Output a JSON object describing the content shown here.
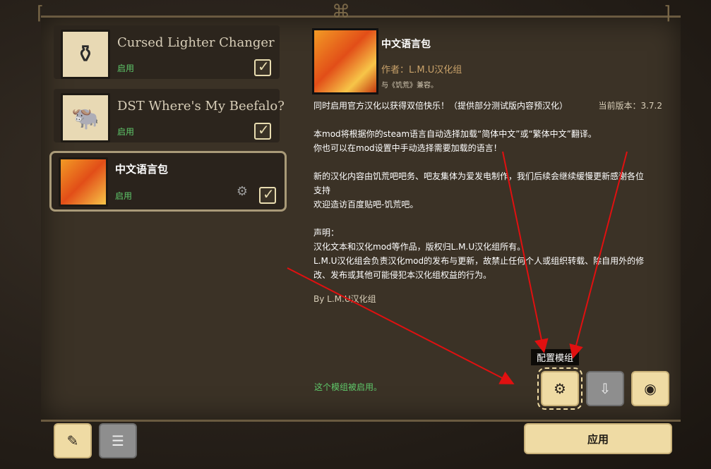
{
  "mods": [
    {
      "name": "Cursed Lighter Changer",
      "status": "启用",
      "icon": "lantern-icon",
      "checked": true
    },
    {
      "name": "DST Where's My Beefalo?",
      "status": "启用",
      "icon": "beefalo-icon",
      "checked": true
    },
    {
      "name": "中文语言包",
      "status": "启用",
      "icon": "wilson-icon",
      "checked": true,
      "selected": true
    }
  ],
  "detail": {
    "title": "中文语言包",
    "author": "作者：L.M.U汉化组",
    "compat": "与《饥荒》兼容。",
    "intro": "同时启用官方汉化以获得双倍快乐！（提供部分测试版内容预汉化）",
    "version": "当前版本：3.7.2",
    "desc1": "本mod将根据你的steam语言自动选择加载“简体中文”或“繁体中文”翻译。",
    "desc2": "你也可以在mod设置中手动选择需要加载的语言！",
    "desc3": "新的汉化内容由饥荒吧吧务、吧友集体为爱发电制作，我们后续会继续缓慢更新感谢各位",
    "desc4": "支持",
    "desc5": "欢迎造访百度贴吧-饥荒吧。",
    "decl_title": "声明：",
    "decl1": "汉化文本和汉化mod等作品，版权归L.M.U汉化组所有。",
    "decl2": "L.M.U汉化组会负责汉化mod的发布与更新，故禁止任何个人或组织转载、除自用外的修",
    "decl3": "改、发布或其他可能侵犯本汉化组权益的行为。",
    "signature": "By L.M.U汉化组"
  },
  "enabled_message": "这个模组被启用。",
  "tooltip": "配置模组",
  "buttons": {
    "configure_icon": "configure-icon",
    "update_icon": "update-icon",
    "workshop_icon": "globe-icon",
    "apply_label": "应用"
  },
  "bottom_left": {
    "clean_icon": "broom-icon",
    "filter_icon": "filter-icon"
  },
  "colors": {
    "enabled_green": "#5fc86a",
    "accent_beige": "#efdba4",
    "arrow_red": "#e01010"
  }
}
